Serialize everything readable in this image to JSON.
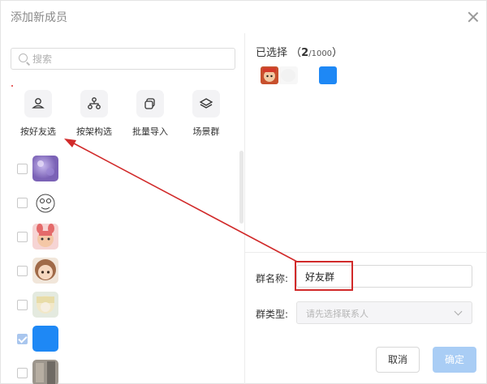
{
  "dialog": {
    "title": "添加新成员"
  },
  "search": {
    "placeholder": "搜索"
  },
  "options": [
    {
      "label": "按好友选",
      "icon": "person-icon"
    },
    {
      "label": "按架构选",
      "icon": "org-chart-icon"
    },
    {
      "label": "批量导入",
      "icon": "import-icon"
    },
    {
      "label": "场景群",
      "icon": "layers-icon"
    }
  ],
  "contacts": [
    {
      "checked": false
    },
    {
      "checked": false
    },
    {
      "checked": false
    },
    {
      "checked": false
    },
    {
      "checked": false
    },
    {
      "checked": true
    },
    {
      "checked": false
    }
  ],
  "selected": {
    "label": "已选择",
    "open": "（",
    "count": "2",
    "total": "/1000",
    "close": "）"
  },
  "form": {
    "group_name_label": "群名称:",
    "group_name_value": "好友群",
    "group_type_label": "群类型:",
    "group_type_placeholder": "请先选择联系人"
  },
  "buttons": {
    "cancel": "取消",
    "confirm": "确定"
  },
  "colors": {
    "accent": "#1e88f5",
    "annotation": "#d12a2a",
    "confirm_disabled": "#a9cdf5"
  }
}
